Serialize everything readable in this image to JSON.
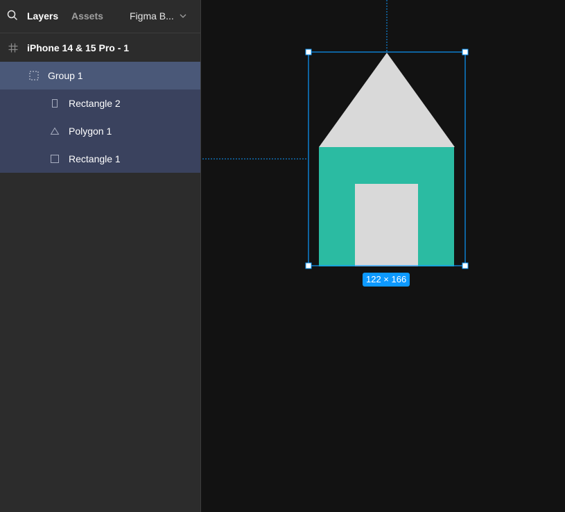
{
  "panel": {
    "tabs": {
      "layers": "Layers",
      "assets": "Assets"
    },
    "page_selector": "Figma B..."
  },
  "layers": {
    "frame": "iPhone 14 & 15 Pro - 1",
    "group": "Group 1",
    "children": [
      "Rectangle 2",
      "Polygon 1",
      "Rectangle 1"
    ]
  },
  "canvas": {
    "selection_size": "122 × 166",
    "colors": {
      "background": "#121212",
      "selection": "#0d99ff",
      "roof": "#d9d9d9",
      "wall": "#2bbba2",
      "door": "#d9d9d9"
    }
  },
  "icons": {
    "search": "search-icon",
    "frame": "frame-hash-icon",
    "group": "group-dashed-icon",
    "rectangle": "rectangle-icon",
    "polygon": "triangle-icon",
    "dropdown": "chevron-down-icon"
  }
}
